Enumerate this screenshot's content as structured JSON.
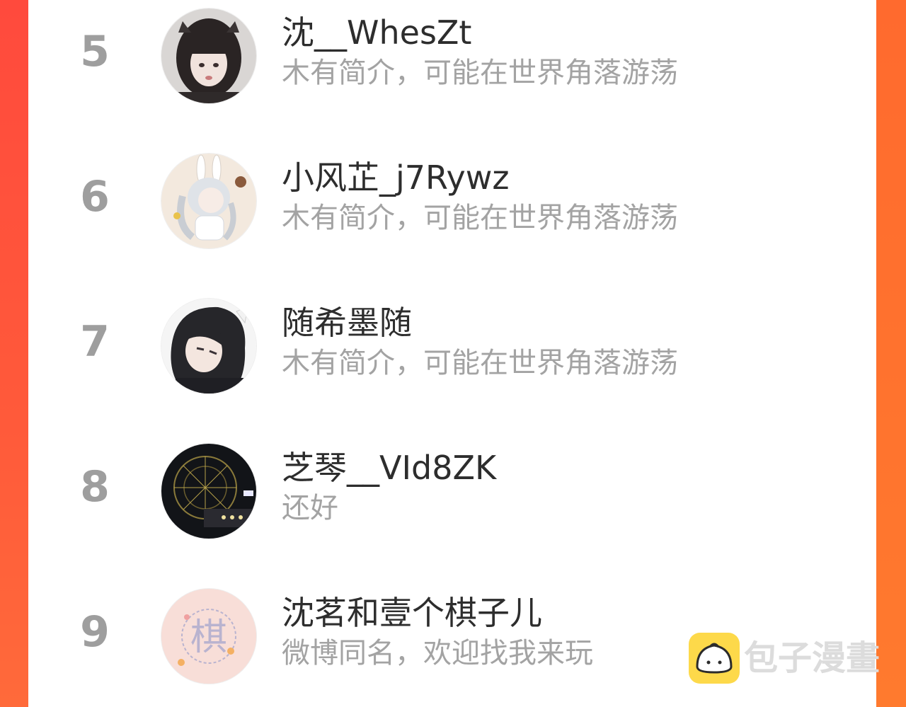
{
  "ranking": [
    {
      "rank": "5",
      "name": "沈__WhesZt",
      "bio": "木有简介，可能在世界角落游荡",
      "avatar": "girl-portrait-avatar"
    },
    {
      "rank": "6",
      "name": "小风芷_j7Rywz",
      "bio": "木有简介，可能在世界角落游荡",
      "avatar": "bunny-anime-avatar"
    },
    {
      "rank": "7",
      "name": "随希墨随",
      "bio": "木有简介，可能在世界角落游荡",
      "avatar": "dark-hair-anime-avatar"
    },
    {
      "rank": "8",
      "name": "芝琴__VId8ZK",
      "bio": "还好",
      "avatar": "ferris-wheel-night-avatar"
    },
    {
      "rank": "9",
      "name": "沈茗和壹个棋子儿",
      "bio": "微博同名，欢迎找我来玩",
      "avatar": "pink-chess-character-avatar",
      "avatar_glyph": "棋"
    }
  ],
  "watermark": {
    "text": "包子漫畫",
    "icon": "bun-logo-icon"
  },
  "colors": {
    "accent_left": "#ff4a3d",
    "accent_right": "#ff7a2e",
    "rank": "#9e9e9e",
    "name": "#2d2d2d",
    "bio": "#a3a3a3",
    "logo": "#fdd94a"
  }
}
